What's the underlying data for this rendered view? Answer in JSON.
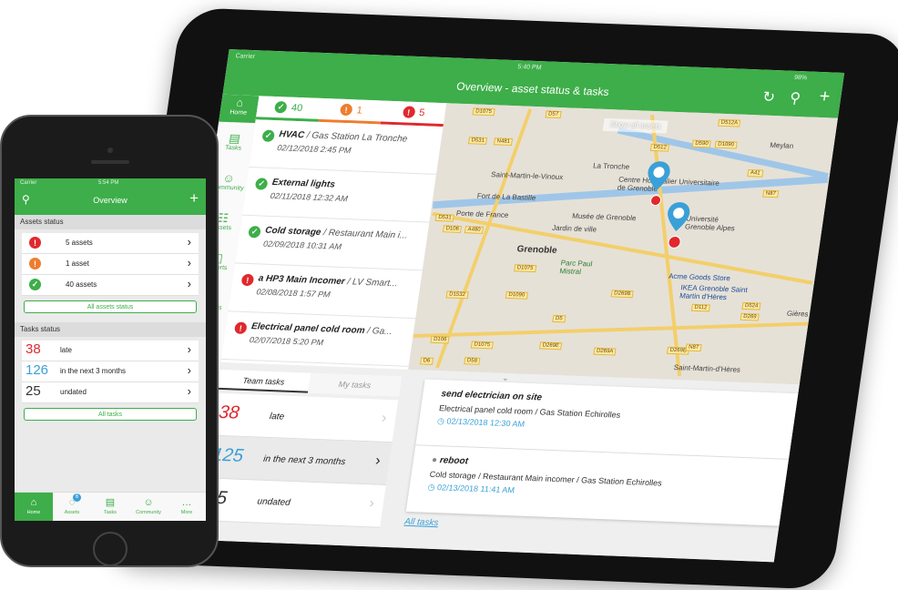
{
  "colors": {
    "green": "#3dae49",
    "red": "#e0282d",
    "orange": "#ee7d2d",
    "blue": "#3aa0d8"
  },
  "tablet": {
    "status": {
      "carrier": "Carrier",
      "time": "5:40 PM",
      "battery": "98%"
    },
    "title": "Overview - asset status & tasks",
    "icons": {
      "refresh": "refresh-icon",
      "search": "search-icon",
      "add": "plus-icon"
    },
    "sidebar": {
      "home": "Home",
      "items": [
        {
          "label": "Tasks",
          "icon": "tasks-icon"
        },
        {
          "label": "Community",
          "icon": "community-icon"
        },
        {
          "label": "Assets",
          "icon": "assets-icon"
        },
        {
          "label": "Reports",
          "icon": "reports-icon"
        },
        {
          "label": "Settings",
          "icon": "settings-icon"
        }
      ]
    },
    "counts": [
      {
        "value": "40",
        "status": "ok"
      },
      {
        "value": "1",
        "status": "warning"
      },
      {
        "value": "5",
        "status": "alert"
      }
    ],
    "tasks": [
      {
        "title": "HVAC",
        "location": " / Gas Station La Tronche",
        "date": "02/12/2018 2:45 PM",
        "status": "ok"
      },
      {
        "title": "External lights",
        "location": "",
        "date": "02/11/2018 12:32 AM",
        "status": "ok"
      },
      {
        "title": "Cold storage",
        "location": " / Restaurant Main i...",
        "date": "02/09/2018 10:31 AM",
        "status": "ok"
      },
      {
        "title": "a HP3 Main Incomer",
        "location": " / LV Smart...",
        "date": "02/08/2018 1:57 PM",
        "status": "alert"
      },
      {
        "title": "Electrical panel cold room",
        "location": " / Ga...",
        "date": "02/07/2018 5:20 PM",
        "status": "alert"
      }
    ],
    "map": {
      "show_all": "Show all assets",
      "places": [
        "Meylan",
        "La Tronche",
        "Saint-Martin-le-Vinoux",
        "Centre Hospitalier Universitaire de Grenoble",
        "Fort de La Bastille",
        "Musée de Grenoble",
        "Jardin de ville",
        "Porte de France",
        "Université Grenoble Alpes",
        "Grenoble",
        "Parc Paul Mistral",
        "Acme Goods Store",
        "IKEA Grenoble Saint Martin d'Hères",
        "Saint-Martin-d'Hères",
        "Gières"
      ],
      "roads": [
        "D1075",
        "D57",
        "D512A",
        "D531",
        "N481",
        "D512",
        "D590",
        "D1090",
        "A41",
        "N87",
        "D531",
        "D106",
        "A480",
        "D1075",
        "D1532",
        "D1090",
        "D269B",
        "D112",
        "D524",
        "D269",
        "D5",
        "D106",
        "D1075",
        "D269E",
        "D269A",
        "D269B",
        "N87",
        "D58",
        "D6"
      ]
    },
    "tabs": {
      "team": "Team tasks",
      "my": "My tasks"
    },
    "stats": [
      {
        "value": "38",
        "label": "late",
        "color": "red"
      },
      {
        "value": "125",
        "label": "in the next 3 months",
        "color": "blue"
      },
      {
        "value": "25",
        "label": "undated",
        "color": "black"
      }
    ],
    "cards": [
      {
        "title": "send electrician on site",
        "subtitle": "Electrical panel cold room / Gas Station Echirolles",
        "date": "02/13/2018 12:30 AM"
      },
      {
        "title": "reboot",
        "subtitle": "Cold storage / Restaurant Main incomer / Gas Station Echirolles",
        "date": "02/13/2018 11:41 AM"
      }
    ],
    "all_tasks": "All tasks"
  },
  "phone": {
    "status": {
      "carrier": "Carrier",
      "time": "5:54 PM"
    },
    "title": "Overview",
    "assets_section": "Assets status",
    "assets": [
      {
        "label": "5 assets",
        "status": "alert"
      },
      {
        "label": "1 asset",
        "status": "warning"
      },
      {
        "label": "40 assets",
        "status": "ok"
      }
    ],
    "all_assets": "All assets status",
    "tasks_section": "Tasks status",
    "tasks": [
      {
        "value": "38",
        "label": "late",
        "color": "red"
      },
      {
        "value": "126",
        "label": "in the next 3 months",
        "color": "blue"
      },
      {
        "value": "25",
        "label": "undated",
        "color": "black"
      }
    ],
    "all_tasks": "All tasks",
    "nav": [
      {
        "label": "Home",
        "icon": "home-icon"
      },
      {
        "label": "Assets",
        "icon": "assets-icon",
        "badge": "6"
      },
      {
        "label": "Tasks",
        "icon": "tasks-icon"
      },
      {
        "label": "Community",
        "icon": "community-icon"
      },
      {
        "label": "More",
        "icon": "more-icon"
      }
    ]
  }
}
